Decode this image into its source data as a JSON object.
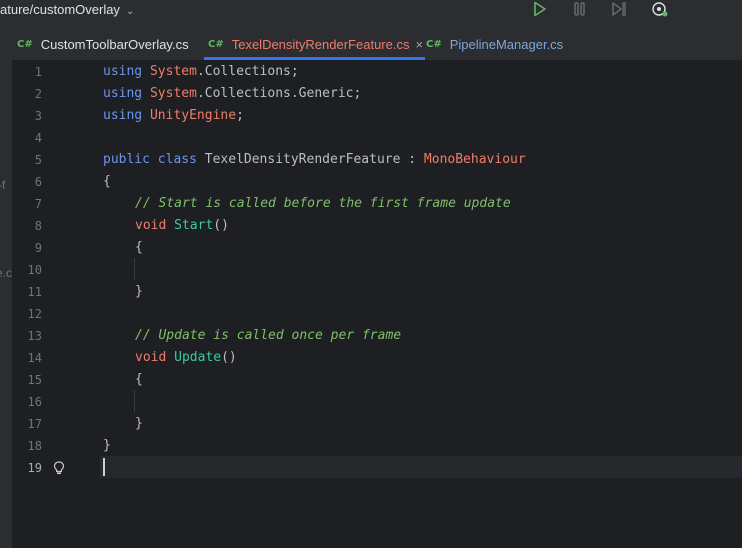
{
  "topbar": {
    "branch": "ature/customOverlay",
    "icons": [
      "run-icon",
      "debug-pause-icon",
      "step-icon",
      "profiler-icon"
    ]
  },
  "tabs": [
    {
      "lang": "C#",
      "label": "CustomToolbarOverlay.cs"
    },
    {
      "lang": "C#",
      "label": "TexelDensityRenderFeature.cs",
      "close": "×"
    },
    {
      "lang": "C#",
      "label": "PipelineManager.cs"
    }
  ],
  "strip": {
    "frag1": "-f",
    "frag2": "e.c"
  },
  "editor": {
    "line_numbers": [
      "1",
      "2",
      "3",
      "4",
      "5",
      "6",
      "7",
      "8",
      "9",
      "10",
      "11",
      "12",
      "13",
      "14",
      "15",
      "16",
      "17",
      "18",
      "19"
    ],
    "current_line": "19",
    "lines": {
      "l1": {
        "kw": "using",
        "ns": "System",
        "rest": ".Collections;"
      },
      "l2": {
        "kw": "using",
        "ns": "System",
        "rest": ".Collections.Generic;"
      },
      "l3": {
        "kw": "using",
        "ns": "UnityEngine",
        "rest": ";"
      },
      "l5": {
        "kw1": "public",
        "kw2": "class",
        "name": "TexelDensityRenderFeature",
        "colon": ":",
        "base": "MonoBehaviour"
      },
      "l6": "{",
      "l7": "// Start is called before the first frame update",
      "l8": {
        "kw": "void",
        "method": "Start",
        "paren": "()"
      },
      "l9": "{",
      "l11": "}",
      "l13": "// Update is called once per frame",
      "l14": {
        "kw": "void",
        "method": "Update",
        "paren": "()"
      },
      "l15": "{",
      "l17": "}",
      "l18": "}"
    }
  },
  "colors": {
    "keyword": "#6c95eb",
    "namespace": "#ee7d6b",
    "comment": "#7fbf6a",
    "method": "#39cc9b",
    "accent": "#3574f0",
    "run": "#5fb865"
  }
}
